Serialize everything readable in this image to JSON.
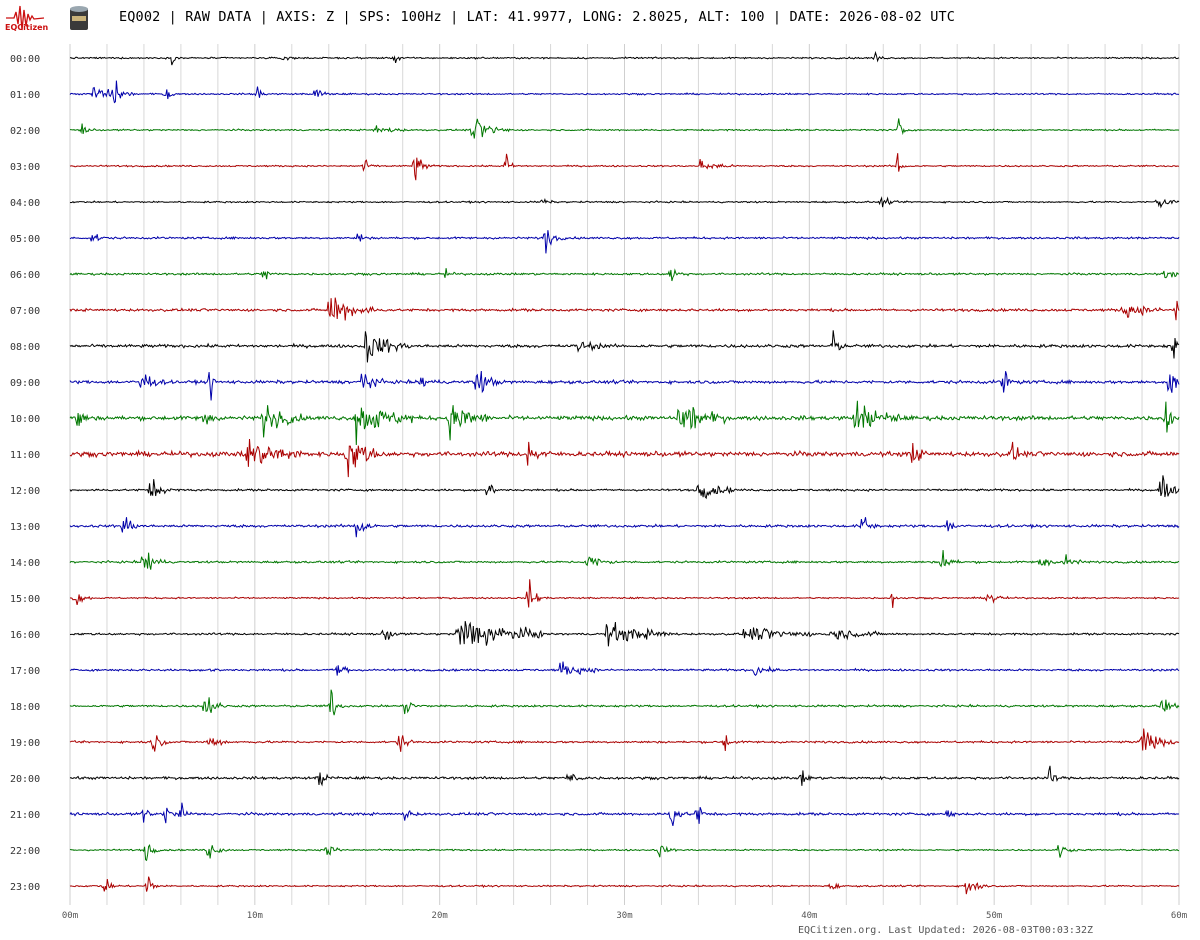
{
  "logo": {
    "text": "EQCitizen",
    "icon": "seismograph-logo-icon",
    "device_icon": "sensor-device-icon"
  },
  "header": {
    "title": "EQ002 | RAW DATA | AXIS: Z | SPS: 100Hz | LAT: 41.9977, LONG: 2.8025, ALT: 100 | DATE: 2026-08-02 UTC"
  },
  "footer": {
    "text": "EQCitizen.org. Last Updated: 2026-08-03T00:03:32Z"
  },
  "colors": {
    "cycle": [
      "#000000",
      "#0000aa",
      "#007700",
      "#aa0000"
    ],
    "grid": "#d8d8d8"
  },
  "chart_data": {
    "type": "line",
    "title": "",
    "xlabel": "",
    "ylabel": "",
    "x_unit": "minutes",
    "xlim": [
      0,
      60
    ],
    "x_ticks": [
      0,
      10,
      20,
      30,
      40,
      50,
      60
    ],
    "x_tick_labels": [
      "00m",
      "10m",
      "20m",
      "30m",
      "40m",
      "50m",
      "60m"
    ],
    "grid": true,
    "rows": [
      {
        "label": "00:00",
        "level": 0.3,
        "events": [
          [
            5.5,
            0.3,
            0.3
          ],
          [
            11.5,
            0.4,
            0.3
          ],
          [
            17.6,
            0.3,
            0.3
          ],
          [
            43.6,
            0.3,
            0.3
          ]
        ]
      },
      {
        "label": "01:00",
        "level": 0.3,
        "events": [
          [
            1.3,
            0.7,
            1.0
          ],
          [
            2.4,
            0.6,
            0.6
          ],
          [
            5.2,
            0.7,
            0.3
          ],
          [
            10.1,
            0.9,
            0.2
          ],
          [
            13.3,
            0.5,
            0.4
          ]
        ]
      },
      {
        "label": "02:00",
        "level": 0.3,
        "events": [
          [
            0.6,
            0.5,
            0.3
          ],
          [
            16.5,
            0.3,
            1.2
          ],
          [
            21.8,
            0.6,
            1.5
          ],
          [
            44.9,
            1.3,
            0.2
          ]
        ]
      },
      {
        "label": "03:00",
        "level": 0.3,
        "events": [
          [
            15.9,
            0.5,
            0.3
          ],
          [
            18.6,
            0.9,
            0.5
          ],
          [
            23.6,
            0.8,
            0.3
          ],
          [
            34.1,
            0.4,
            1.2
          ],
          [
            44.8,
            1.0,
            0.3
          ]
        ]
      },
      {
        "label": "04:00",
        "level": 0.3,
        "events": [
          [
            25.6,
            0.3,
            0.3
          ],
          [
            43.9,
            0.4,
            0.4
          ],
          [
            58.8,
            0.5,
            0.8
          ]
        ]
      },
      {
        "label": "05:00",
        "level": 0.4,
        "events": [
          [
            1.2,
            0.4,
            0.4
          ],
          [
            15.6,
            0.4,
            0.3
          ],
          [
            25.7,
            0.8,
            0.5
          ]
        ]
      },
      {
        "label": "06:00",
        "level": 0.4,
        "events": [
          [
            10.5,
            0.4,
            0.3
          ],
          [
            20.3,
            0.3,
            0.3
          ],
          [
            32.5,
            0.6,
            0.4
          ],
          [
            59.3,
            0.5,
            0.4
          ]
        ]
      },
      {
        "label": "07:00",
        "level": 0.5,
        "events": [
          [
            14.0,
            0.8,
            2.0
          ],
          [
            57.0,
            0.4,
            1.5
          ],
          [
            59.8,
            0.8,
            0.4
          ]
        ]
      },
      {
        "label": "08:00",
        "level": 0.6,
        "events": [
          [
            16.0,
            0.8,
            1.8
          ],
          [
            27.5,
            0.4,
            1.0
          ],
          [
            41.3,
            1.0,
            0.3
          ],
          [
            59.7,
            1.1,
            0.4
          ]
        ]
      },
      {
        "label": "09:00",
        "level": 0.6,
        "events": [
          [
            3.8,
            0.7,
            0.8
          ],
          [
            7.6,
            0.9,
            0.2
          ],
          [
            15.8,
            0.8,
            0.7
          ],
          [
            19.0,
            0.6,
            0.5
          ],
          [
            22.0,
            0.7,
            0.9
          ],
          [
            50.5,
            0.8,
            0.4
          ],
          [
            59.5,
            1.2,
            0.4
          ]
        ]
      },
      {
        "label": "10:00",
        "level": 0.8,
        "events": [
          [
            0.4,
            0.8,
            0.4
          ],
          [
            7.3,
            0.8,
            0.3
          ],
          [
            10.5,
            0.9,
            1.5
          ],
          [
            15.5,
            1.0,
            2.5
          ],
          [
            20.5,
            1.0,
            1.5
          ],
          [
            33.0,
            0.8,
            2.0
          ],
          [
            42.5,
            0.7,
            2.0
          ],
          [
            59.3,
            1.0,
            0.5
          ]
        ]
      },
      {
        "label": "11:00",
        "level": 0.9,
        "events": [
          [
            9.5,
            0.8,
            2.5
          ],
          [
            15.0,
            1.2,
            1.3
          ],
          [
            24.8,
            0.7,
            0.7
          ],
          [
            45.6,
            0.6,
            0.5
          ],
          [
            51.0,
            0.7,
            0.3
          ]
        ]
      },
      {
        "label": "12:00",
        "level": 0.4,
        "events": [
          [
            4.3,
            0.7,
            0.8
          ],
          [
            22.6,
            0.8,
            0.3
          ],
          [
            34.0,
            0.5,
            1.5
          ],
          [
            59.0,
            1.1,
            0.6
          ]
        ]
      },
      {
        "label": "13:00",
        "level": 0.5,
        "events": [
          [
            2.9,
            0.7,
            0.5
          ],
          [
            15.5,
            1.0,
            0.5
          ],
          [
            42.9,
            0.8,
            0.4
          ],
          [
            47.5,
            0.4,
            0.4
          ]
        ]
      },
      {
        "label": "14:00",
        "level": 0.4,
        "events": [
          [
            4.0,
            1.1,
            0.6
          ],
          [
            28.0,
            0.5,
            1.0
          ],
          [
            47.2,
            0.7,
            0.5
          ],
          [
            52.5,
            0.7,
            0.4
          ],
          [
            53.8,
            0.5,
            0.6
          ]
        ]
      },
      {
        "label": "15:00",
        "level": 0.3,
        "events": [
          [
            0.3,
            0.5,
            0.5
          ],
          [
            24.8,
            0.9,
            0.5
          ],
          [
            44.5,
            0.4,
            0.3
          ],
          [
            49.7,
            0.6,
            0.5
          ]
        ]
      },
      {
        "label": "16:00",
        "level": 0.4,
        "events": [
          [
            17.0,
            0.5,
            0.5
          ],
          [
            21.0,
            0.9,
            4.0
          ],
          [
            29.0,
            0.6,
            3.0
          ],
          [
            36.5,
            0.4,
            3.0
          ],
          [
            41.0,
            0.3,
            2.5
          ]
        ]
      },
      {
        "label": "17:00",
        "level": 0.4,
        "events": [
          [
            7.5,
            0.4,
            0.3
          ],
          [
            14.5,
            0.7,
            0.5
          ],
          [
            26.5,
            0.4,
            1.5
          ],
          [
            37.0,
            0.4,
            0.8
          ]
        ]
      },
      {
        "label": "18:00",
        "level": 0.4,
        "events": [
          [
            7.3,
            0.8,
            0.6
          ],
          [
            14.1,
            1.0,
            0.4
          ],
          [
            18.2,
            0.8,
            0.5
          ],
          [
            59.1,
            0.8,
            0.4
          ]
        ]
      },
      {
        "label": "19:00",
        "level": 0.4,
        "events": [
          [
            4.5,
            0.6,
            0.5
          ],
          [
            7.5,
            0.6,
            0.6
          ],
          [
            17.8,
            0.5,
            0.5
          ],
          [
            35.4,
            0.6,
            0.3
          ],
          [
            58.0,
            0.7,
            1.2
          ]
        ]
      },
      {
        "label": "20:00",
        "level": 0.5,
        "events": [
          [
            13.5,
            0.5,
            0.5
          ],
          [
            27.0,
            0.5,
            0.5
          ],
          [
            39.6,
            0.6,
            0.3
          ],
          [
            53.0,
            0.6,
            0.3
          ]
        ]
      },
      {
        "label": "21:00",
        "level": 0.5,
        "events": [
          [
            4.0,
            0.6,
            0.3
          ],
          [
            5.2,
            0.7,
            0.3
          ],
          [
            6.0,
            0.8,
            0.3
          ],
          [
            18.2,
            0.6,
            0.3
          ],
          [
            32.5,
            0.8,
            0.5
          ],
          [
            33.9,
            0.9,
            0.3
          ],
          [
            47.5,
            0.4,
            0.3
          ]
        ]
      },
      {
        "label": "22:00",
        "level": 0.3,
        "events": [
          [
            4.1,
            0.7,
            0.4
          ],
          [
            7.5,
            0.5,
            0.6
          ],
          [
            13.9,
            0.6,
            0.5
          ],
          [
            31.9,
            0.5,
            0.4
          ],
          [
            53.5,
            0.5,
            0.5
          ]
        ]
      },
      {
        "label": "23:00",
        "level": 0.3,
        "events": [
          [
            1.8,
            0.5,
            0.5
          ],
          [
            4.2,
            1.0,
            0.3
          ],
          [
            41.2,
            0.5,
            0.3
          ],
          [
            48.5,
            0.7,
            0.6
          ]
        ]
      }
    ],
    "note_fields": "events are [minute, relative_amplitude, duration_minutes]"
  }
}
